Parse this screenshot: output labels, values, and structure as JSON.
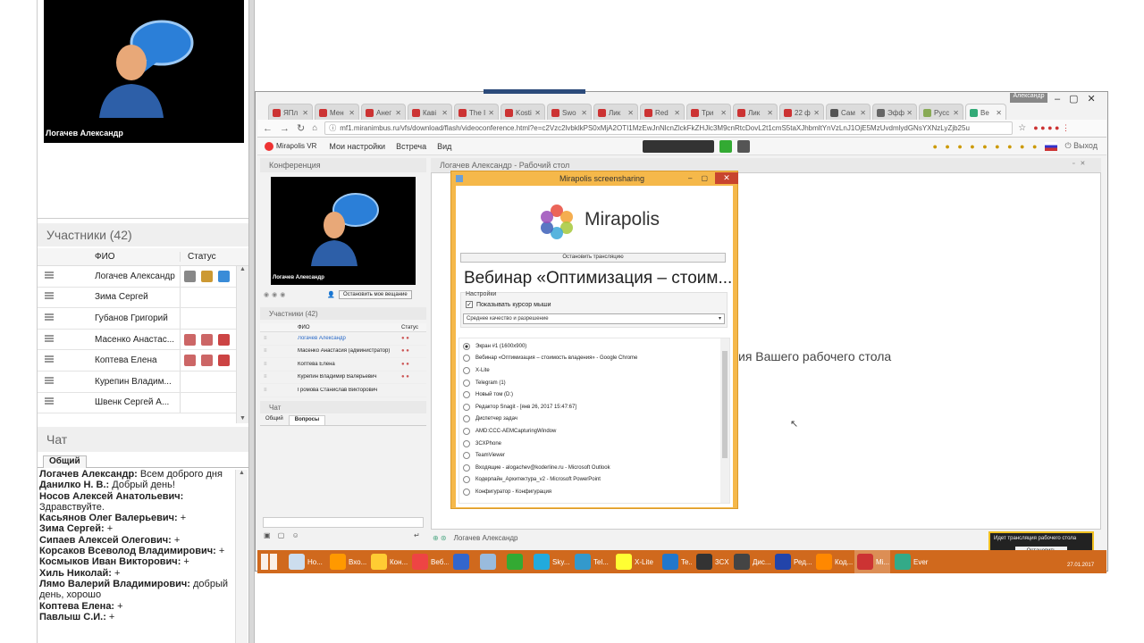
{
  "left": {
    "video_name": "Логачев Александр",
    "participants_title": "Участники (42)",
    "col_name": "ФИО",
    "col_status": "Статус",
    "participants": [
      "Логачев Александр",
      "Зима Сергей",
      "Губанов Григорий",
      "Масенко Анастас...",
      "Коптева Елена",
      "Курепин Владим...",
      "Швенк Сергей А..."
    ],
    "chat_title": "Чат",
    "chat_tab": "Общий",
    "messages": [
      {
        "author": "Логачев Александр:",
        "text": " Всем доброго дня"
      },
      {
        "author": "Данилко Н. В.:",
        "text": " Добрый день!"
      },
      {
        "author": "Носов Алексей Анатольевич:",
        "text": " Здравствуйте."
      },
      {
        "author": "Касьянов Олег Валерьевич:",
        "text": " +"
      },
      {
        "author": "Зима Сергей:",
        "text": " +"
      },
      {
        "author": "Сипаев Алексей Олегович:",
        "text": " +"
      },
      {
        "author": "Корсаков Всеволод Владимирович:",
        "text": " +"
      },
      {
        "author": "Космыков Иван Викторович:",
        "text": " +"
      },
      {
        "author": "Хиль Николай:",
        "text": " +"
      },
      {
        "author": "Лямо Валерий  Владимирович:",
        "text": " добрый день, хорошо"
      },
      {
        "author": "Коптева Елена:",
        "text": " +"
      },
      {
        "author": "Павлыш С.И.:",
        "text": " +"
      }
    ]
  },
  "browser": {
    "window_label": "Александр",
    "tabs": [
      "ЯПл",
      "Мен",
      "Анег",
      "Каві",
      "The I",
      "Kosti",
      "Swo",
      "Лик",
      "Red",
      "Три",
      "Лик",
      "22 ф",
      "Сам",
      "Эфф",
      "Русс",
      "Ве"
    ],
    "url": "mf1.miranimbus.ru/vfs/download/flash/videoconference.html?e=c2Vzc2lvbklkPS0xMjA2OTI1MzEwJnNlcnZlckFkZHJlc3M9cnRtcDovL2t1cmS5taXJhbmltYnVzLnJ1OjE5MzUvdmlydGNsYXNzLyZjb25u",
    "menu": [
      "Мои настройки",
      "Встреча",
      "Вид"
    ],
    "logo": "Mirapolis VR",
    "exit": "Выход"
  },
  "conf": {
    "title": "Конференция",
    "video_name": "Логачев Александр",
    "stop_btn": "Остановить мое вещание",
    "participants_title": "Участники (42)",
    "col_name": "ФИО",
    "col_status": "Статус",
    "participants": [
      "Логачев Александр",
      "Масенко Анастасия (администратор)",
      "Коптева Елена",
      "Курепин Владимир Валерьевич",
      "Громова Станислав Викторович"
    ],
    "chat_title": "Чат",
    "chat_tabs": [
      "Общий",
      "Вопросы"
    ]
  },
  "desktop": {
    "title": "Логачев Александр - Рабочий стол",
    "bg_text": "ия Вашего рабочего стола",
    "footer_name": "Логачев Александр",
    "notice_text": "Идет трансляция рабочего стола",
    "notice_btn": "Остановить"
  },
  "dialog": {
    "title": "Mirapolis screensharing",
    "logo_text": "Mirapolis",
    "stop_btn": "Остановить трансляцию",
    "heading": "Вебинар «Оптимизация – стоим...",
    "settings_label": "Настройки",
    "checkbox_label": "Показывать курсор мыши",
    "quality": "Среднее качество и разрешение",
    "sources": [
      "Экран #1 (1600x900)",
      "Вебинар «Оптимизация – стоимость владения» - Google Chrome",
      "X-Lite",
      "Telegram (1)",
      "Новый том (D:)",
      "Редактор Snagit - [янв 26, 2017 15:47:67]",
      "Диспетчер задач",
      "AMD:CCC-AEMCapturingWindow",
      "3CXPhone",
      "TeamViewer",
      "Входящие - alogachev@koderline.ru - Microsoft Outlook",
      "Кодерлайн_Архитектура_v2 - Microsoft PowerPoint",
      "Конфигуратор - Конфигурация"
    ]
  },
  "taskbar": {
    "items": [
      "Но...",
      "Вхо...",
      "Кон...",
      "Веб...",
      "",
      "",
      "",
      "Sky...",
      "Tel...",
      "X-Lite",
      "Te...",
      "3CX...",
      "Дис...",
      "Ред...",
      "Код...",
      "Mi...",
      "Ever"
    ],
    "date": "27.01.2017"
  }
}
